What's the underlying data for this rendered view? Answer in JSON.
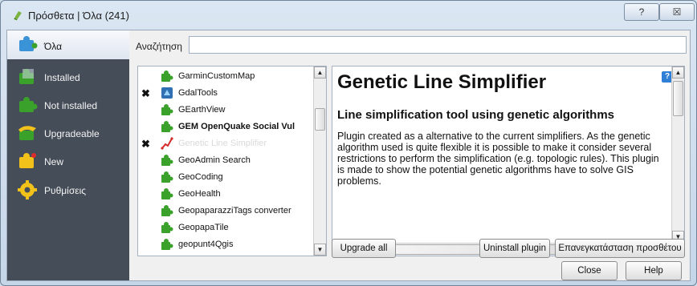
{
  "window": {
    "title": "Πρόσθετα | Όλα (241)",
    "help_glyph": "?",
    "close_glyph": "☒"
  },
  "sidebar": {
    "items": [
      {
        "label": "Όλα",
        "icon": "puzzle-all-icon",
        "active": true
      },
      {
        "label": "Installed",
        "icon": "puzzle-installed-icon"
      },
      {
        "label": "Not installed",
        "icon": "puzzle-not-installed-icon"
      },
      {
        "label": "Upgradeable",
        "icon": "puzzle-upgradeable-icon"
      },
      {
        "label": "New",
        "icon": "puzzle-new-icon"
      },
      {
        "label": "Ρυθμίσεις",
        "icon": "gear-settings-icon"
      }
    ]
  },
  "search": {
    "label": "Αναζήτηση",
    "value": ""
  },
  "plugins": [
    {
      "name": "GarminCustomMap",
      "check": ""
    },
    {
      "name": "GdalTools",
      "check": "✖"
    },
    {
      "name": "GEarthView",
      "check": ""
    },
    {
      "name": "GEM OpenQuake Social Vul",
      "check": "",
      "bold": true
    },
    {
      "name": "Genetic Line Simplifier",
      "check": "✖",
      "selected": true
    },
    {
      "name": "GeoAdmin Search",
      "check": ""
    },
    {
      "name": "GeoCoding",
      "check": ""
    },
    {
      "name": "GeoHealth",
      "check": ""
    },
    {
      "name": "GeopaparazziTags converter",
      "check": ""
    },
    {
      "name": "GeopapaTile",
      "check": ""
    },
    {
      "name": "geopunt4Qgis",
      "check": ""
    }
  ],
  "details": {
    "title": "Genetic Line Simplifier",
    "subtitle": "Line simplification tool using genetic algorithms",
    "description": "Plugin created as a alternative to the current simplifiers. As the genetic algorithm used is quite flexible it is possible to make it consider several restrictions to perform the simplification (e.g. topologic rules). This plugin is made to show the potential genetic algorithms have to solve GIS problems.",
    "badge": "?"
  },
  "buttons": {
    "upgrade_all": "Upgrade all",
    "uninstall": "Uninstall plugin",
    "reinstall": "Επανεγκατάσταση προσθέτου",
    "close": "Close",
    "help": "Help"
  },
  "colors": {
    "sidebar_bg": "#454d58",
    "plugin_green": "#3aa12a",
    "badge_blue": "#2f7fd6"
  }
}
